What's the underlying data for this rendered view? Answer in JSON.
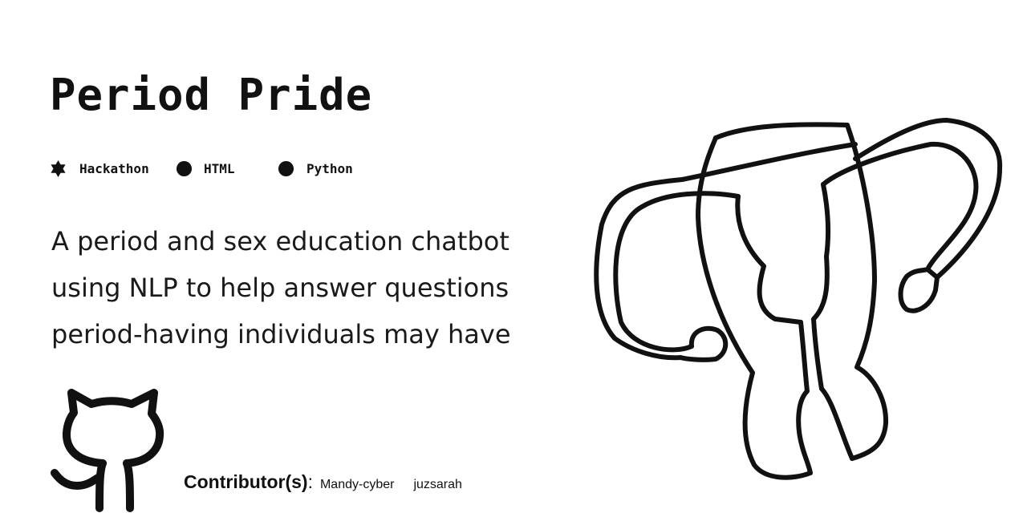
{
  "title": "Period Pride",
  "tags": [
    {
      "label": "Hackathon",
      "icon": "star-burst-icon"
    },
    {
      "label": "HTML",
      "icon": "dot-icon"
    },
    {
      "label": "Python",
      "icon": "dot-icon"
    }
  ],
  "description": "A period and sex education chatbot using NLP to help answer questions period-having individuals may have",
  "contributors": {
    "label": "Contributor(s)",
    "colon": ":",
    "names": [
      "Mandy-cyber",
      "juzsarah"
    ]
  },
  "icons": {
    "github": "github-octocat-icon",
    "illustration": "uterus-drawing"
  },
  "colors": {
    "ink": "#111111",
    "background": "#ffffff"
  }
}
